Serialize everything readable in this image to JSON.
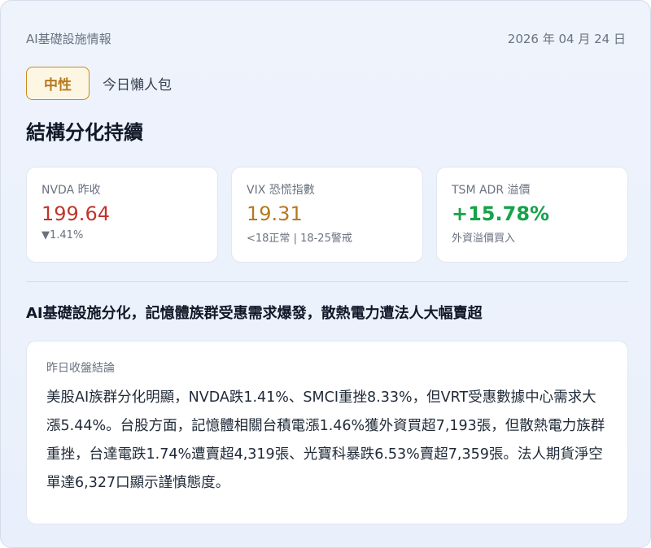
{
  "header": {
    "source": "AI基礎設施情報",
    "date": "2026 年 04 月 24 日"
  },
  "tag": {
    "sentiment": "中性",
    "tagline": "今日懶人包"
  },
  "title": "結構分化持續",
  "metrics": [
    {
      "label": "NVDA 昨收",
      "value": "199.64",
      "sub": "▼1.41%",
      "color": "#c0352b"
    },
    {
      "label": "VIX 恐慌指數",
      "value": "19.31",
      "sub": "<18正常 | 18-25警戒",
      "color": "#b7791f"
    },
    {
      "label": "TSM ADR 溢價",
      "value": "+15.78%",
      "sub": "外資溢價買入",
      "color": "#16a34a"
    }
  ],
  "headline": "AI基礎設施分化，記憶體族群受惠需求爆發，散熱電力遭法人大幅賣超",
  "summary": {
    "label": "昨日收盤結論",
    "body": "美股AI族群分化明顯，NVDA跌1.41%、SMCI重挫8.33%，但VRT受惠數據中心需求大漲5.44%。台股方面，記憶體相關台積電漲1.46%獲外資買超7,193張，但散熱電力族群重挫，台達電跌1.74%遭賣超4,319張、光寶科暴跌6.53%賣超7,359張。法人期貨淨空單達6,327口顯示謹慎態度。"
  }
}
